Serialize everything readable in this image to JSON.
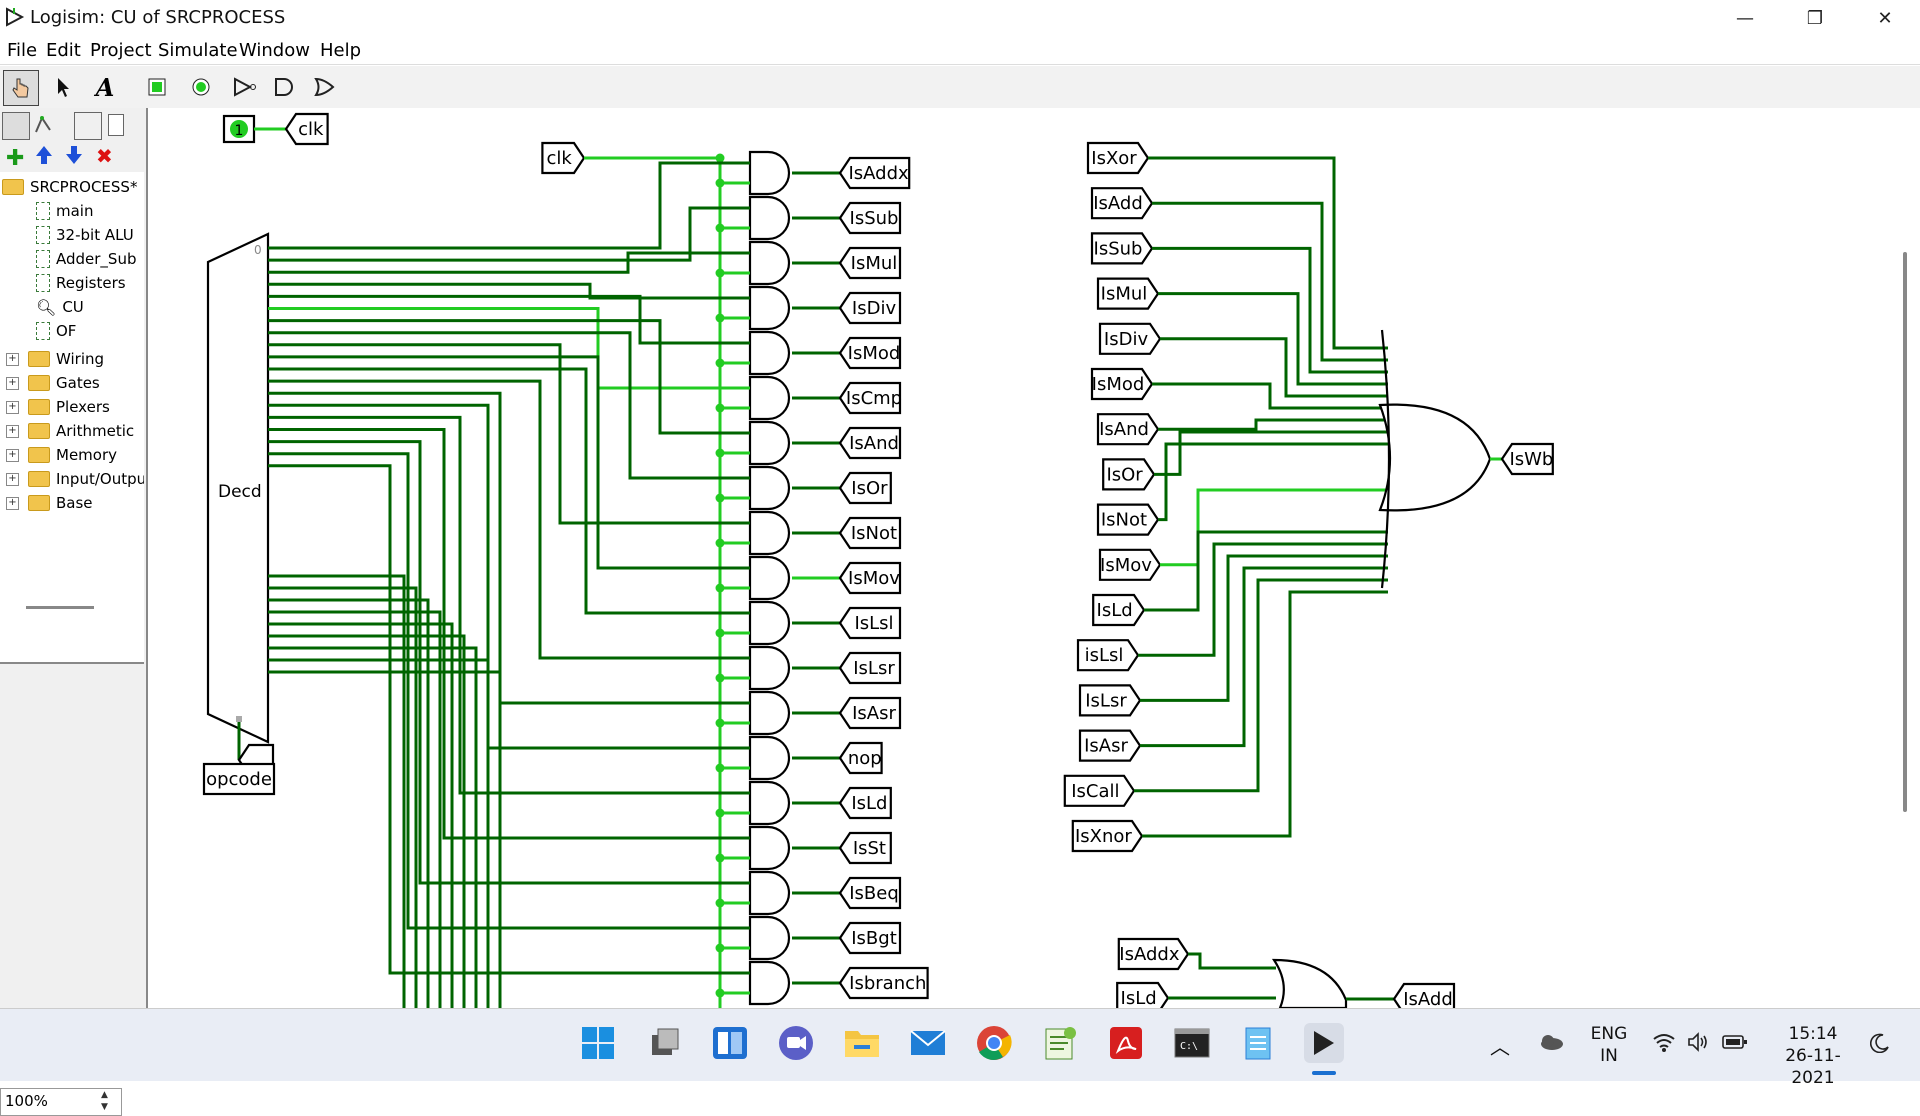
{
  "window": {
    "title": "Logisim: CU of SRCPROCESS",
    "minimize": "—",
    "restore": "❐",
    "close": "✕"
  },
  "menu": [
    "File",
    "Edit",
    "Project",
    "Simulate",
    "Window",
    "Help"
  ],
  "tree": {
    "root": "SRCPROCESS*",
    "circuits": [
      "main",
      "32-bit ALU",
      "Adder_Sub",
      "Registers",
      "CU",
      "OF"
    ],
    "libraries": [
      "Wiring",
      "Gates",
      "Plexers",
      "Arithmetic",
      "Memory",
      "Input/Output",
      "Base"
    ]
  },
  "zoom": "100%",
  "circuit": {
    "clock_value": "1",
    "clock_label": "clk",
    "clk_input": "clk",
    "decoder_label": "Decd",
    "decoder_pin0": "0",
    "opcode_label": "opcode",
    "decoder_outputs": [
      "IsAddx",
      "IsSub",
      "IsMul",
      "IsDiv",
      "IsMod",
      "IsCmp",
      "IsAnd",
      "IsOr",
      "IsNot",
      "IsMov",
      "IsLsl",
      "IsLsr",
      "IsAsr",
      "nop",
      "IsLd",
      "IsSt",
      "IsBeq",
      "IsBgt",
      "Isbranch"
    ],
    "or_inputs": [
      "IsXor",
      "IsAdd",
      "IsSub",
      "IsMul",
      "IsDiv",
      "IsMod",
      "IsAnd",
      "IsOr",
      "IsNot",
      "IsMov",
      "IsLd",
      "isLsl",
      "IsLsr",
      "IsAsr",
      "IsCall",
      "IsXnor"
    ],
    "or_output": "IsWb",
    "or2_inputs": [
      "IsAddx",
      "IsLd"
    ],
    "or2_output": "IsAdd"
  },
  "colors": {
    "wire": "#006400",
    "wire_active": "#22cc22",
    "folder": "#f1c44c"
  },
  "taskbar": {
    "icons": [
      "windows-start-icon",
      "task-view-icon",
      "widgets-icon",
      "chat-icon",
      "file-explorer-icon",
      "mail-icon",
      "chrome-icon",
      "notepad-plus-icon",
      "acrobat-icon",
      "terminal-icon",
      "notepad-icon",
      "logisim-icon"
    ],
    "lang_line1": "ENG",
    "lang_line2": "IN",
    "time": "15:14",
    "date": "26-11-2021"
  }
}
